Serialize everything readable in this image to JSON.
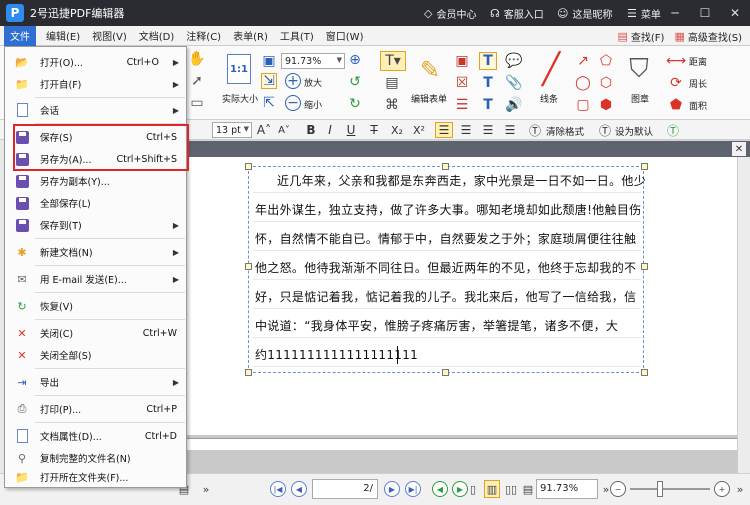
{
  "window": {
    "app_logo": "P",
    "title": "2号迅捷PDF编辑器",
    "member_center": "会员中心",
    "service_entry": "客服入口",
    "user_name": "这是昵称",
    "menu": "菜单"
  },
  "menubar": {
    "items": [
      "文件",
      "编辑(E)",
      "视图(V)",
      "文档(D)",
      "注释(C)",
      "表单(R)",
      "工具(T)",
      "窗口(W)"
    ],
    "find": "查找(F)",
    "advanced_find": "高级查找(S)"
  },
  "ribbon": {
    "zoom": "91.73%",
    "zoom_in": "放大",
    "zoom_out": "缩小",
    "actual_size": "实际大小",
    "edit_form": "编辑表单",
    "lines": "线条",
    "stamp": "图章",
    "distance": "距离",
    "perimeter": "周长",
    "area": "面积"
  },
  "formatbar": {
    "font_size": "13 pt",
    "bold": "B",
    "italic": "I",
    "underline": "U",
    "strike": "T",
    "subscript": "X₂",
    "superscript": "X²",
    "clear_format": "清除格式",
    "set_default": "设为默认"
  },
  "file_menu": {
    "items": [
      {
        "label": "打开(O)...",
        "shortcut": "Ctrl+O",
        "submenu": true
      },
      {
        "label": "打开自(F)",
        "shortcut": "",
        "submenu": true
      },
      {
        "label": "会话",
        "shortcut": "",
        "submenu": true
      },
      {
        "label": "保存(S)",
        "shortcut": "Ctrl+S",
        "submenu": false
      },
      {
        "label": "另存为(A)...",
        "shortcut": "Ctrl+Shift+S",
        "submenu": false
      },
      {
        "label": "另存为副本(Y)...",
        "shortcut": "",
        "submenu": false
      },
      {
        "label": "全部保存(L)",
        "shortcut": "",
        "submenu": false
      },
      {
        "label": "保存到(T)",
        "shortcut": "",
        "submenu": true
      },
      {
        "label": "新建文档(N)",
        "shortcut": "",
        "submenu": true
      },
      {
        "label": "用 E-mail 发送(E)...",
        "shortcut": "",
        "submenu": true
      },
      {
        "label": "恢复(V)",
        "shortcut": "",
        "submenu": false
      },
      {
        "label": "关闭(C)",
        "shortcut": "Ctrl+W",
        "submenu": false
      },
      {
        "label": "关闭全部(S)",
        "shortcut": "",
        "submenu": false
      },
      {
        "label": "导出",
        "shortcut": "",
        "submenu": true
      },
      {
        "label": "打印(P)...",
        "shortcut": "Ctrl+P",
        "submenu": false
      },
      {
        "label": "文档属性(D)...",
        "shortcut": "Ctrl+D",
        "submenu": false
      },
      {
        "label": "复制完整的文件名(N)",
        "shortcut": "",
        "submenu": false
      },
      {
        "label": "打开所在文件夹(F)...",
        "shortcut": "",
        "submenu": false
      }
    ]
  },
  "document": {
    "lines": [
      "近几年来，父亲和我都是东奔西走，家中光景是一日不如一日。他少",
      "年出外谋生，独立支持，做了许多大事。哪知老境却如此颓唐!他触目伤",
      "怀，自然情不能自已。情郁于中，自然要发之于外；家庭琐屑便往往触",
      "他之怒。他待我渐渐不同往日。但最近两年的不见，他终于忘却我的不",
      "好，只是惦记着我，惦记着我的儿子。我北来后，他写了一信给我，信",
      "中说道：“我身体平安，惟膀子疼痛厉害，举箸提笔，诸多不便，大",
      "约1111111111111111111"
    ]
  },
  "statusbar": {
    "page": "2/",
    "zoom": "91.73%"
  }
}
